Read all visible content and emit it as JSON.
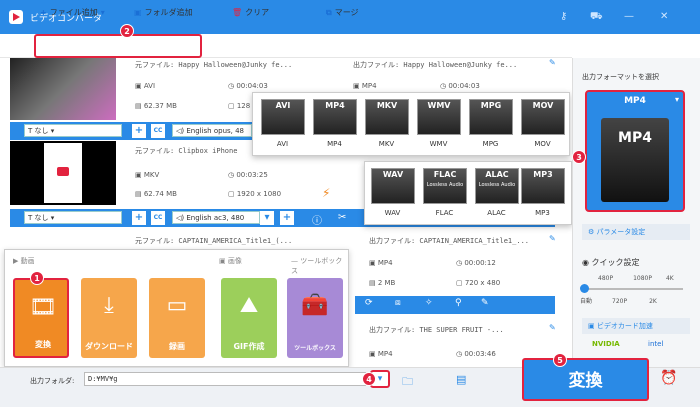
{
  "app": {
    "title": "ビデオコンバータ"
  },
  "toolbar": {
    "add_file": "ファイル追加",
    "add_folder": "フォルダ追加",
    "clear": "クリア",
    "merge": "マージ"
  },
  "files": [
    {
      "source": "元ファイル: Happy Halloween@Junky fe...",
      "format": "AVI",
      "duration": "00:04:03",
      "size": "62.37 MB",
      "resolution": "128",
      "output": "出力ファイル: Happy Halloween@Junky fe...",
      "out_format": "MP4",
      "out_duration": "00:04:03",
      "subtitle": "なし",
      "audio": "English opus, 48"
    },
    {
      "source": "元ファイル: Clipbox  iPhone",
      "format": "MKV",
      "duration": "00:03:25",
      "size": "62.74 MB",
      "resolution": "1920 x 1080",
      "subtitle": "なし",
      "audio": "English ac3, 480"
    },
    {
      "source": "元ファイル: CAPTAIN_AMERICA_Title1_(...",
      "output": "出力ファイル: CAPTAIN_AMERICA_Title1_...",
      "out_format": "MP4",
      "out_duration": "00:00:12",
      "out_size": "2 MB",
      "out_resolution": "720 x 480"
    },
    {
      "output": "出力ファイル: THE SUPER FRUIT -...",
      "out_format": "MP4",
      "out_duration": "00:03:46"
    }
  ],
  "formats_video": [
    "AVI",
    "MP4",
    "MKV",
    "WMV",
    "MPG",
    "MOV"
  ],
  "formats_audio": [
    "WAV",
    "FLAC",
    "ALAC",
    "MP3"
  ],
  "lossless_tag": "Lossless Audio",
  "tool_panel": {
    "section_video": "動画",
    "section_image": "画像",
    "section_toolbox": "ツールボックス",
    "cards": [
      "変換",
      "ダウンロード",
      "録画",
      "GIF作成",
      "ツールボックス"
    ]
  },
  "right_panel": {
    "select_label": "出力フォーマットを選択",
    "selected_format": "MP4",
    "param_settings": "パラメータ設定",
    "quick_settings": "クイック設定",
    "quality_top": [
      "480P",
      "1080P",
      "4K"
    ],
    "quality_bottom": [
      "自動",
      "720P",
      "2K"
    ],
    "gpu_accel": "ビデオカード加速",
    "nvidia": "NVIDIA",
    "intel": "intel"
  },
  "bottom": {
    "output_folder_label": "出力フォルダ:",
    "output_folder_value": "D:¥MV¥g",
    "convert_label": "変換"
  },
  "badges": [
    "1",
    "2",
    "3",
    "4",
    "5"
  ],
  "colors": {
    "accent": "#2a8ae6",
    "highlight": "#e2233f",
    "card": "#f6a64b",
    "card_active": "#f08a24",
    "toolbox": "#a78ad6",
    "gif": "#9ccf5b"
  }
}
